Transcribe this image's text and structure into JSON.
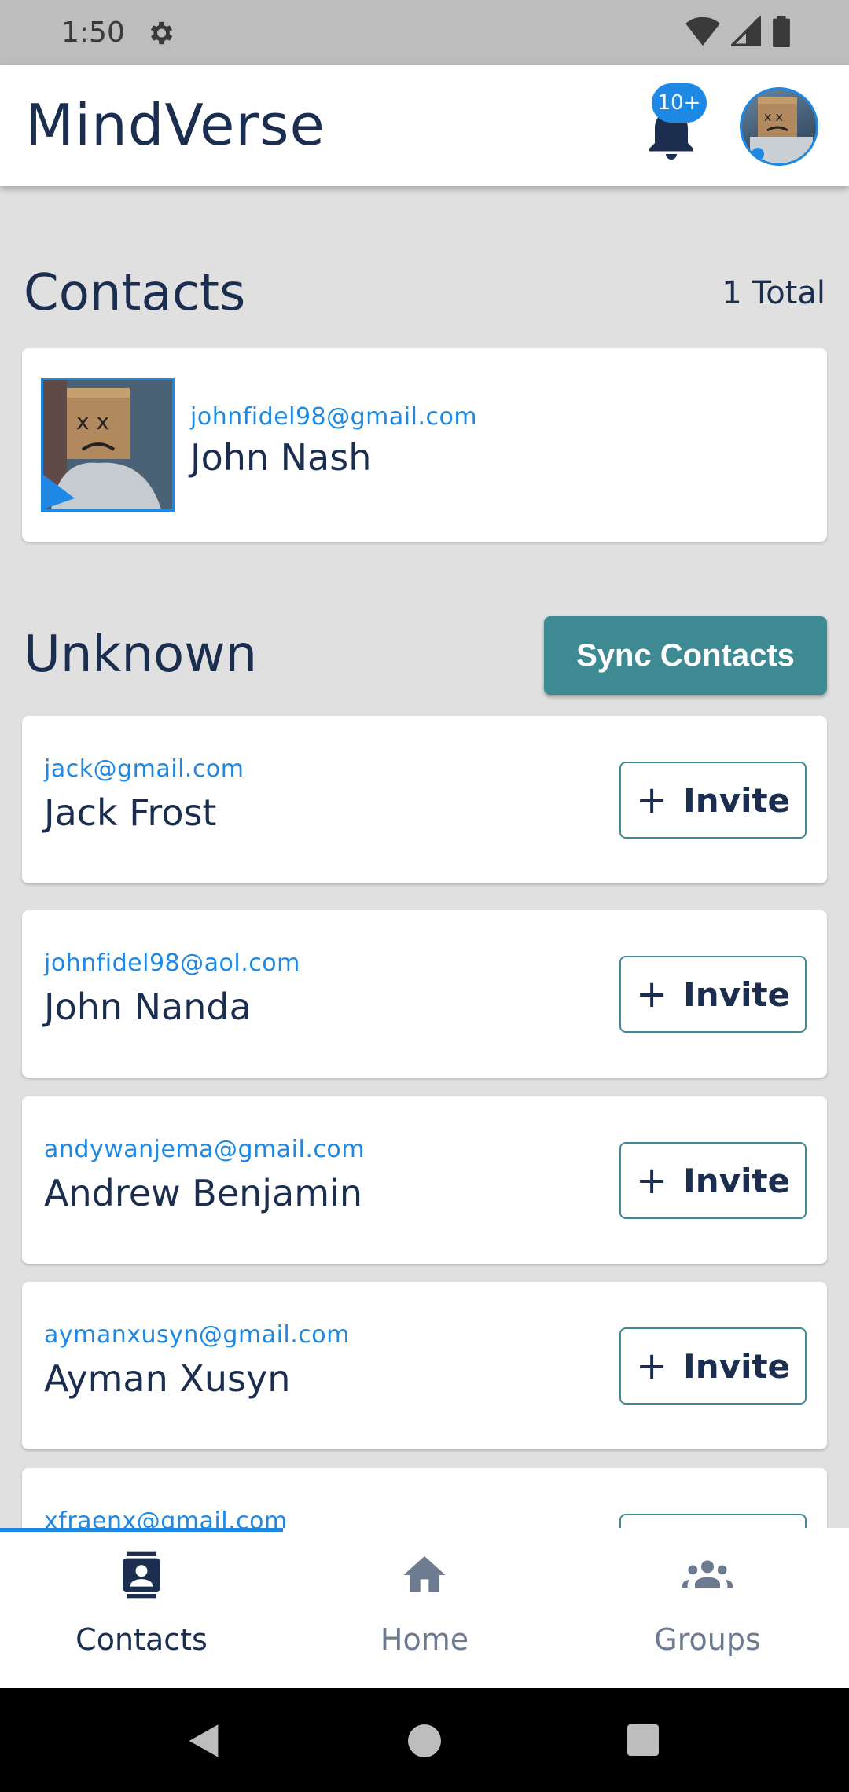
{
  "status_bar": {
    "time": "1:50"
  },
  "app_bar": {
    "title": "MindVerse",
    "notification_badge": "10+"
  },
  "contacts_section": {
    "title": "Contacts",
    "total": "1 Total",
    "items": [
      {
        "email": "johnfidel98@gmail.com",
        "name": "John Nash"
      }
    ]
  },
  "unknown_section": {
    "title": "Unknown",
    "sync_label": "Sync Contacts",
    "invite_label": "Invite",
    "items": [
      {
        "email": "jack@gmail.com",
        "name": "Jack Frost"
      },
      {
        "email": "johnfidel98@aol.com",
        "name": "John Nanda"
      },
      {
        "email": "andywanjema@gmail.com",
        "name": "Andrew Benjamin"
      },
      {
        "email": "aymanxusyn@gmail.com",
        "name": "Ayman Xusyn"
      },
      {
        "email": "xfraenx@gmail.com",
        "name": ""
      }
    ]
  },
  "bottom_nav": {
    "items": [
      {
        "label": "Contacts",
        "icon": "contacts-icon",
        "active": true
      },
      {
        "label": "Home",
        "icon": "home-icon",
        "active": false
      },
      {
        "label": "Groups",
        "icon": "groups-icon",
        "active": false
      }
    ]
  },
  "colors": {
    "accent": "#1e88e5",
    "teal": "#3e8a93",
    "text": "#1c2e4f",
    "background": "#e0e0e0"
  }
}
